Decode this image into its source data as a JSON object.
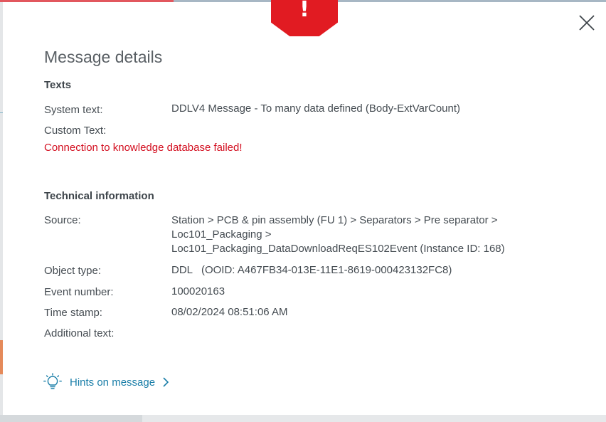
{
  "dialog": {
    "title": "Message details",
    "warning_icon": "exclamation-icon",
    "close_icon": "close-icon",
    "warning_glyph": "!"
  },
  "texts": {
    "heading": "Texts",
    "system_text_label": "System text:",
    "system_text_value": "DDLV4 Message - To many data defined (Body-ExtVarCount)",
    "custom_text_label": "Custom Text:",
    "custom_text_value": "Connection to knowledge database failed!"
  },
  "technical": {
    "heading": "Technical information",
    "source_label": "Source:",
    "source_lines": [
      "Station > PCB & pin assembly (FU 1) > Separators > Pre separator >",
      "Loc101_Packaging >",
      "Loc101_Packaging_DataDownloadReqES102Event  (Instance ID: 168)"
    ],
    "object_type_label": "Object type:",
    "object_type_value": "DDL   (OOID: A467FB34-013E-11E1-8619-000423132FC8)",
    "event_number_label": "Event number:",
    "event_number_value": "100020163",
    "time_stamp_label": "Time stamp:",
    "time_stamp_value": "08/02/2024 08:51:06 AM",
    "additional_text_label": "Additional text:",
    "additional_text_value": ""
  },
  "hints": {
    "label": "Hints on message",
    "icon": "lightbulb-icon",
    "chevron_icon": "chevron-right-icon"
  },
  "colors": {
    "warning_red": "#e11b22",
    "error_text": "#d30f20",
    "link_blue": "#1a7ea8"
  }
}
